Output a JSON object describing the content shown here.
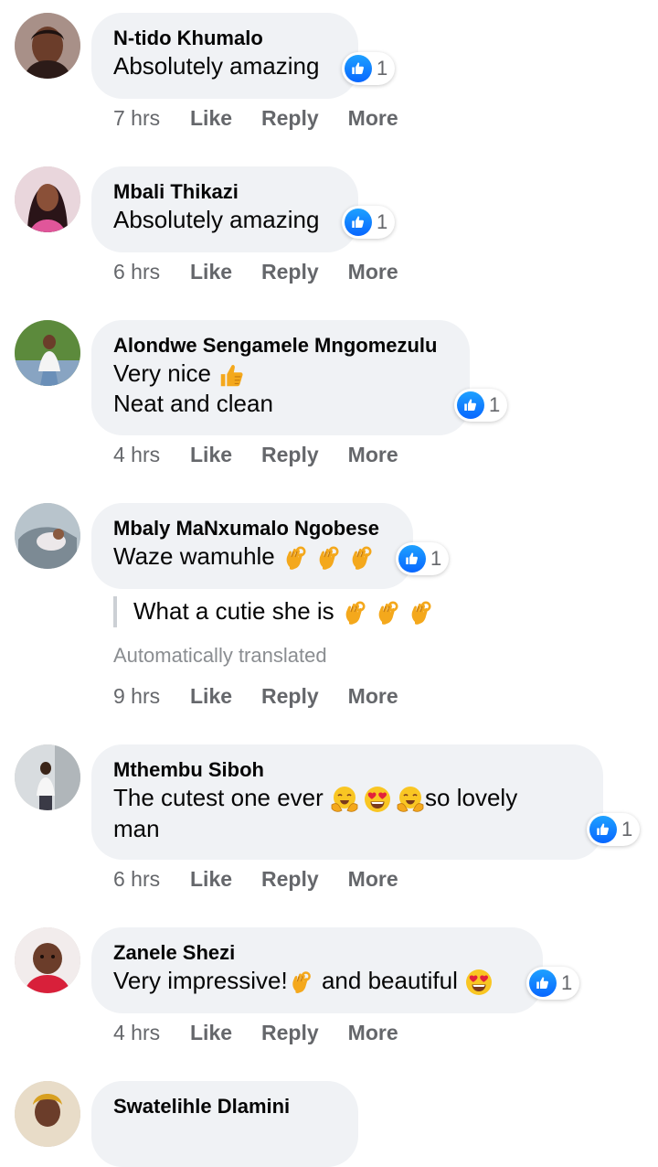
{
  "actions": {
    "like": "Like",
    "reply": "Reply",
    "more": "More"
  },
  "accent_color": "#0866ff",
  "comments": [
    {
      "name": "N-tido Khumalo",
      "lines": [
        "Absolutely amazing"
      ],
      "reaction": {
        "icon": "like-icon",
        "count": "1"
      },
      "time": "7 hrs"
    },
    {
      "name": "Mbali Thikazi",
      "lines": [
        "Absolutely amazing"
      ],
      "reaction": {
        "icon": "like-icon",
        "count": "1"
      },
      "time": "6 hrs"
    },
    {
      "name": "Alondwe Sengamele Mngomezulu",
      "lines": [
        "Very nice",
        "Neat and clean"
      ],
      "line_emojis": [
        "thumbs-up-emoji"
      ],
      "reaction": {
        "icon": "like-icon",
        "count": "1"
      },
      "time": "4 hrs"
    },
    {
      "name": "Mbaly MaNxumalo Ngobese",
      "lines": [
        "Waze wamuhle"
      ],
      "line_emojis": [
        "ok-hand-emoji x3"
      ],
      "translation": "What a cutie she is",
      "translation_emojis": [
        "ok-hand-emoji x3"
      ],
      "translation_note": "Automatically translated",
      "reaction": {
        "icon": "like-icon",
        "count": "1"
      },
      "time": "9 hrs"
    },
    {
      "name": "Mthembu Siboh",
      "lines": [
        "The cutest one ever",
        "so lovely",
        "man"
      ],
      "line_emojis": [
        "hugging-emoji",
        "heart-eyes-emoji",
        "hugging-emoji"
      ],
      "reaction": {
        "icon": "like-icon",
        "count": "1"
      },
      "time": "6 hrs"
    },
    {
      "name": "Zanele Shezi",
      "lines": [
        "Very impressive!",
        "and beautiful"
      ],
      "line_emojis": [
        "ok-hand-emoji",
        "heart-eyes-emoji"
      ],
      "reaction": {
        "icon": "like-icon",
        "count": "1"
      },
      "time": "4 hrs"
    },
    {
      "name": "Swatelihle Dlamini"
    }
  ]
}
